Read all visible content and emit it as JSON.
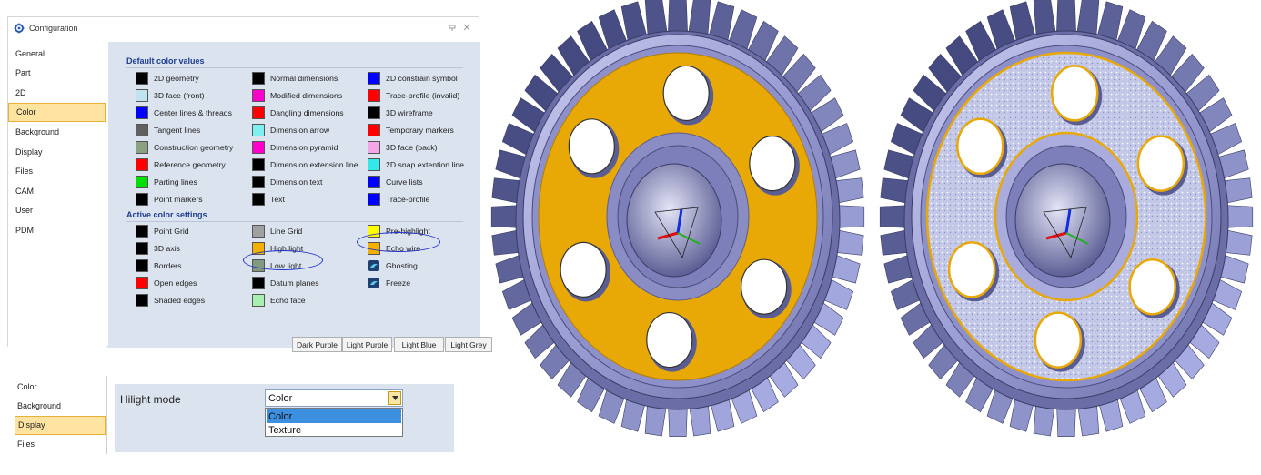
{
  "window": {
    "title": "Configuration"
  },
  "nav": {
    "items": [
      "General",
      "Part",
      "2D",
      "Color",
      "Background",
      "Display",
      "Files",
      "CAM",
      "User",
      "PDM"
    ],
    "selected_index": 3
  },
  "default_section": {
    "title": "Default color values",
    "columns": [
      [
        {
          "label": "2D geometry",
          "color": "#000000"
        },
        {
          "label": "3D face (front)",
          "color": "#bfe3ef"
        },
        {
          "label": "Center lines & threads",
          "color": "#0000ff"
        },
        {
          "label": "Tangent lines",
          "color": "#606060"
        },
        {
          "label": "Construction geometry",
          "color": "#8aa082"
        },
        {
          "label": "Reference geometry",
          "color": "#ff0000"
        },
        {
          "label": "Parting lines",
          "color": "#00e000"
        },
        {
          "label": "Point markers",
          "color": "#000000"
        }
      ],
      [
        {
          "label": "Normal dimensions",
          "color": "#000000"
        },
        {
          "label": "Modified dimensions",
          "color": "#ff00cc"
        },
        {
          "label": "Dangling dimensions",
          "color": "#ff0000"
        },
        {
          "label": "Dimension arrow",
          "color": "#7ff0f0"
        },
        {
          "label": "Dimension pyramid",
          "color": "#ff00cc"
        },
        {
          "label": "Dimension extension line",
          "color": "#000000"
        },
        {
          "label": "Dimension text",
          "color": "#000000"
        },
        {
          "label": "Text",
          "color": "#000000"
        }
      ],
      [
        {
          "label": "2D constrain symbol",
          "color": "#0000ff"
        },
        {
          "label": "Trace-profile (invalid)",
          "color": "#ff0000"
        },
        {
          "label": "3D wireframe",
          "color": "#000000"
        },
        {
          "label": "Temporary markers",
          "color": "#ff0000"
        },
        {
          "label": "3D face (back)",
          "color": "#f4a6e8"
        },
        {
          "label": "2D snap extention line",
          "color": "#33e8e8"
        },
        {
          "label": "Curve lists",
          "color": "#0000ff"
        },
        {
          "label": "Trace-profile",
          "color": "#0000ff"
        }
      ]
    ]
  },
  "active_section": {
    "title": "Active color settings",
    "columns": [
      [
        {
          "label": "Point Grid",
          "color": "#000000"
        },
        {
          "label": "3D axis",
          "color": "#000000"
        },
        {
          "label": "Borders",
          "color": "#000000"
        },
        {
          "label": "Open edges",
          "color": "#ff0000"
        },
        {
          "label": "Shaded edges",
          "color": "#000000"
        }
      ],
      [
        {
          "label": "Line Grid",
          "color": "#a0a0a0"
        },
        {
          "label": "High light",
          "color": "#f2b000"
        },
        {
          "label": "Low light",
          "color": "#7f9a80"
        },
        {
          "label": "Datum planes",
          "color": "#000000"
        },
        {
          "label": "Echo face",
          "color": "#a8f0b0"
        }
      ],
      [
        {
          "label": "Pre-highlight",
          "color": "#ffff00",
          "icon": ""
        },
        {
          "label": "Echo wire",
          "color": "#f2b000",
          "icon": ""
        },
        {
          "label": "Ghosting",
          "color": "#2a7fd0",
          "icon": "ghost-icon"
        },
        {
          "label": "Freeze",
          "color": "#2a7fd0",
          "icon": "freeze-icon"
        }
      ]
    ]
  },
  "presets": [
    "Dark Purple",
    "Light Purple",
    "Light Blue",
    "Light Grey"
  ],
  "panel2": {
    "nav_items": [
      "Color",
      "Background",
      "Display",
      "Files"
    ],
    "selected_index": 2,
    "mode_label": "Hilight mode",
    "combo_value": "Color",
    "options": [
      "Color",
      "Texture"
    ],
    "selected_option": 0
  },
  "colors": {
    "highlight": "#e8a806",
    "gear_steel": "#9c9fd6",
    "ellipse": "#1e2fc9",
    "texture_base": "#c5c9e8",
    "panel_bg": "#dbe3ee"
  },
  "viewports": [
    {
      "name": "gear-color-highlight",
      "mode": "color"
    },
    {
      "name": "gear-texture-highlight",
      "mode": "texture"
    }
  ]
}
